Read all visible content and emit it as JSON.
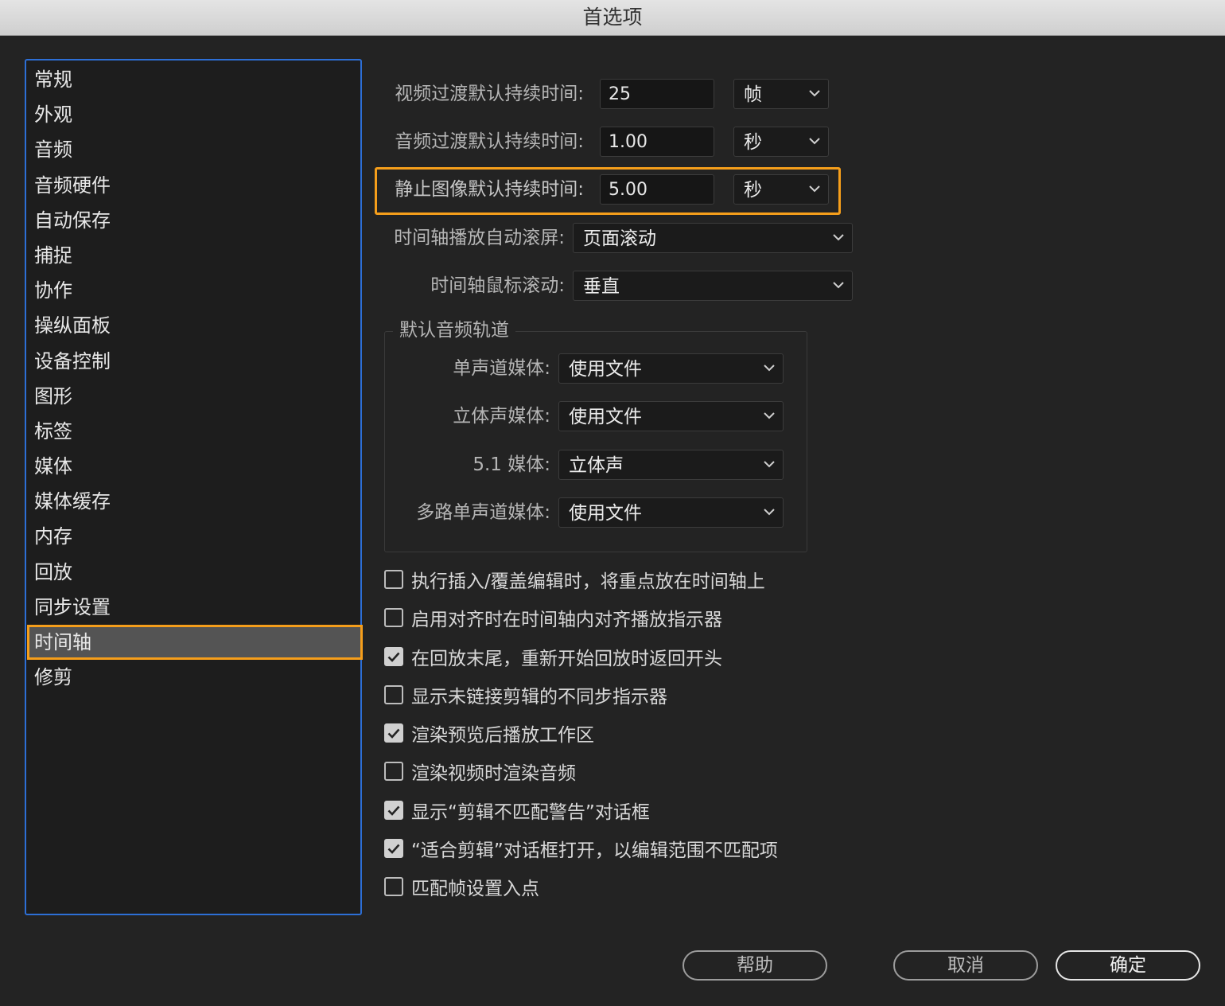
{
  "window": {
    "title": "首选项"
  },
  "sidebar": {
    "items": [
      {
        "label": "常规"
      },
      {
        "label": "外观"
      },
      {
        "label": "音频"
      },
      {
        "label": "音频硬件"
      },
      {
        "label": "自动保存"
      },
      {
        "label": "捕捉"
      },
      {
        "label": "协作"
      },
      {
        "label": "操纵面板"
      },
      {
        "label": "设备控制"
      },
      {
        "label": "图形"
      },
      {
        "label": "标签"
      },
      {
        "label": "媒体"
      },
      {
        "label": "媒体缓存"
      },
      {
        "label": "内存"
      },
      {
        "label": "回放"
      },
      {
        "label": "同步设置"
      },
      {
        "label": "时间轴",
        "selected": true
      },
      {
        "label": "修剪"
      }
    ]
  },
  "timeline": {
    "video_transition": {
      "label": "视频过渡默认持续时间:",
      "value": "25",
      "unit": "帧"
    },
    "audio_transition": {
      "label": "音频过渡默认持续时间:",
      "value": "1.00",
      "unit": "秒"
    },
    "still_image": {
      "label": "静止图像默认持续时间:",
      "value": "5.00",
      "unit": "秒"
    },
    "autoscroll": {
      "label": "时间轴播放自动滚屏:",
      "value": "页面滚动"
    },
    "mouse_scroll": {
      "label": "时间轴鼠标滚动:",
      "value": "垂直"
    },
    "audio_tracks": {
      "title": "默认音频轨道",
      "mono": {
        "label": "单声道媒体:",
        "value": "使用文件"
      },
      "stereo": {
        "label": "立体声媒体:",
        "value": "使用文件"
      },
      "surround": {
        "label": "5.1 媒体:",
        "value": "立体声"
      },
      "multimono": {
        "label": "多路单声道媒体:",
        "value": "使用文件"
      }
    },
    "checkboxes": [
      {
        "label": "执行插入/覆盖编辑时，将重点放在时间轴上",
        "checked": false
      },
      {
        "label": "启用对齐时在时间轴内对齐播放指示器",
        "checked": false
      },
      {
        "label": "在回放末尾，重新开始回放时返回开头",
        "checked": true
      },
      {
        "label": "显示未链接剪辑的不同步指示器",
        "checked": false
      },
      {
        "label": "渲染预览后播放工作区",
        "checked": true
      },
      {
        "label": "渲染视频时渲染音频",
        "checked": false
      },
      {
        "label": "显示“剪辑不匹配警告”对话框",
        "checked": true
      },
      {
        "label": "“适合剪辑”对话框打开，以编辑范围不匹配项",
        "checked": true
      },
      {
        "label": "匹配帧设置入点",
        "checked": false
      }
    ]
  },
  "buttons": {
    "help": "帮助",
    "cancel": "取消",
    "ok": "确定"
  },
  "colors": {
    "highlight": "#f59e1b",
    "sidebar_border": "#2d6fd6",
    "background": "#232323"
  }
}
